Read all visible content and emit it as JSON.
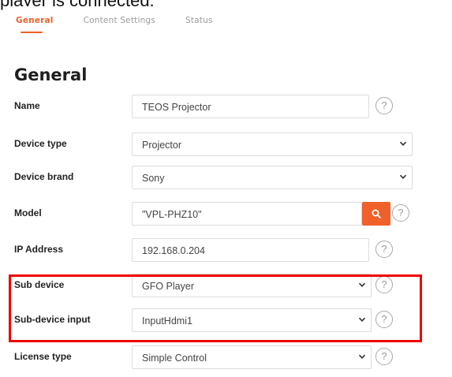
{
  "caption": "player is connected.",
  "tabs": [
    {
      "label": "General",
      "active": true
    },
    {
      "label": "Content Settings",
      "active": false
    },
    {
      "label": "Status",
      "active": false
    }
  ],
  "section_title": "General",
  "fields": {
    "name": {
      "label": "Name",
      "value": "TEOS Projector"
    },
    "device_type": {
      "label": "Device type",
      "value": "Projector"
    },
    "device_brand": {
      "label": "Device brand",
      "value": "Sony"
    },
    "model": {
      "label": "Model",
      "value": "\"VPL-PHZ10\""
    },
    "ip_address": {
      "label": "IP Address",
      "value": "192.168.0.204"
    },
    "sub_device": {
      "label": "Sub device",
      "value": "GFO Player"
    },
    "sub_device_input": {
      "label": "Sub-device input",
      "value": "InputHdmi1"
    },
    "license_type": {
      "label": "License type",
      "value": "Simple Control"
    }
  },
  "help_symbol": "?",
  "colors": {
    "accent": "#f0602a",
    "highlight": "#f00000"
  },
  "icons": {
    "search": "search-icon",
    "help": "help-icon",
    "chevron": "chevron-down-icon"
  }
}
